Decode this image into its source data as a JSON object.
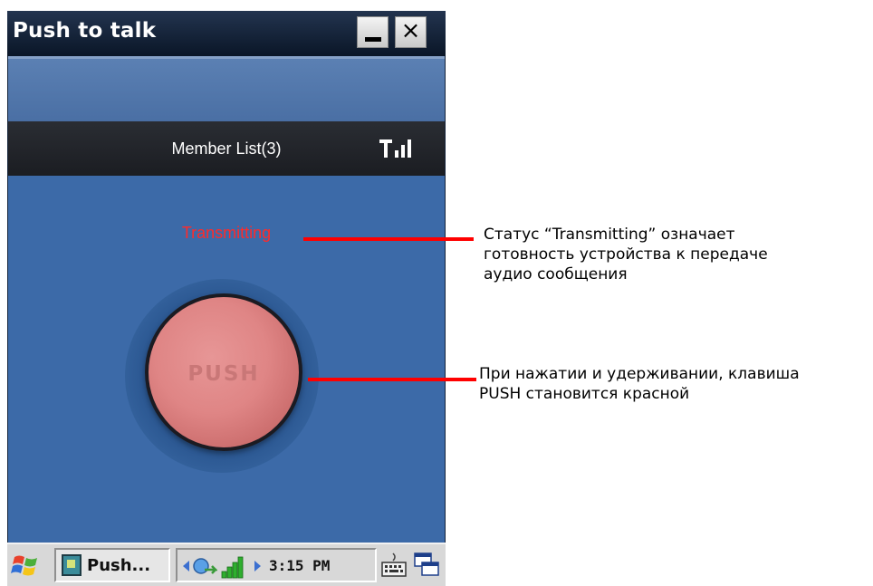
{
  "window": {
    "title": "Push to talk",
    "minimize_icon": "minimize-icon",
    "close_glyph": "×"
  },
  "app": {
    "member_list_label": "Member List(3)",
    "signal_icon": "signal-strength-icon",
    "status_text": "Transmitting",
    "status_color": "#ff2a2a",
    "push_button_label": "PUSH",
    "push_button_color": "#df8585",
    "background_color": "#3c6aa8"
  },
  "taskbar": {
    "start_icon": "windows-start-icon",
    "task_label": "Push...",
    "clock": "3:15 PM",
    "tray_icons": [
      "arrow-left-icon",
      "network-icon",
      "signal-bars-icon",
      "arrow-right-icon"
    ],
    "keyboard_icon": "keyboard-icon",
    "switch_window_icon": "switch-window-icon"
  },
  "annotations": {
    "line_color": "#ff0000",
    "status_note": "Статус “Transmitting” означает\nготовность устройства к передаче\nаудио сообщения",
    "push_note": "При нажатии и удерживании, клавиша\nPUSH становится красной"
  }
}
